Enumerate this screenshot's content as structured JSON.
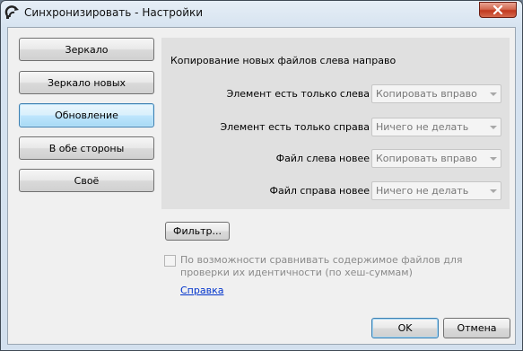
{
  "window": {
    "title": "Синхронизировать - Настройки"
  },
  "modes": [
    {
      "label": "Зеркало"
    },
    {
      "label": "Зеркало новых"
    },
    {
      "label": "Обновление"
    },
    {
      "label": "В обе стороны"
    },
    {
      "label": "Своё"
    }
  ],
  "selected_mode": "Обновление",
  "panel": {
    "description": "Копирование новых файлов слева направо",
    "rows": [
      {
        "label": "Элемент есть только слева",
        "value": "Копировать вправо"
      },
      {
        "label": "Элемент есть только справа",
        "value": "Ничего не делать"
      },
      {
        "label": "Файл слева новее",
        "value": "Копировать вправо"
      },
      {
        "label": "Файл справа новее",
        "value": "Ничего не делать"
      }
    ]
  },
  "filter_button": "Фильтр...",
  "compare_checkbox": {
    "label": "По возможности сравнивать содержимое файлов для проверки их идентичности (по хеш-суммам)",
    "checked": false,
    "enabled": false
  },
  "help_link": "Справка",
  "buttons": {
    "ok": "OK",
    "cancel": "Отмена"
  },
  "colors": {
    "close_button": "#c2391f",
    "selected_mode": "#bee6fd",
    "link": "#0033cc"
  }
}
